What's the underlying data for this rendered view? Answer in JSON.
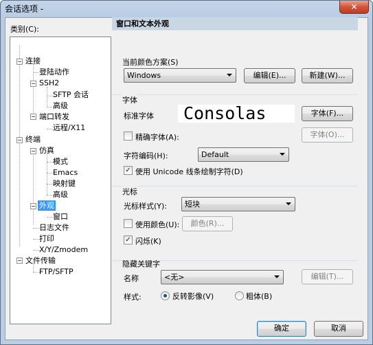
{
  "window": {
    "title": "会话选项 -",
    "close_glyph": "✕"
  },
  "category_label": "类别(C):",
  "tree": [
    {
      "label": "连接",
      "level": 0
    },
    {
      "label": "登陆动作",
      "level": 1
    },
    {
      "label": "SSH2",
      "level": 1
    },
    {
      "label": "SFTP 会话",
      "level": 2
    },
    {
      "label": "高级",
      "level": 2
    },
    {
      "label": "端口转发",
      "level": 1
    },
    {
      "label": "远程/X11",
      "level": 2
    },
    {
      "label": "终端",
      "level": 0
    },
    {
      "label": "仿真",
      "level": 1
    },
    {
      "label": "模式",
      "level": 2
    },
    {
      "label": "Emacs",
      "level": 2
    },
    {
      "label": "映射键",
      "level": 2
    },
    {
      "label": "高级",
      "level": 2
    },
    {
      "label": "外观",
      "level": 1,
      "selected": true
    },
    {
      "label": "窗口",
      "level": 2
    },
    {
      "label": "日志文件",
      "level": 1
    },
    {
      "label": "打印",
      "level": 1
    },
    {
      "label": "X/Y/Zmodem",
      "level": 1
    },
    {
      "label": "文件传输",
      "level": 0
    },
    {
      "label": "FTP/SFTP",
      "level": 1
    }
  ],
  "panel": {
    "header": "窗口和文本外观",
    "color_scheme": {
      "label": "当前颜色方案(S)",
      "value": "Windows",
      "edit": "编辑(E)...",
      "new": "新建(W)..."
    },
    "font": {
      "group_label": "字体",
      "standard_label": "标准字体",
      "standard_value": "Consolas",
      "font_button": "字体(F)...",
      "precise_label": "精确字体(A):",
      "precise_checked": false,
      "precise_button": "字体(O)...",
      "encoding_label": "字符编码(H):",
      "encoding_value": "Default",
      "unicode_label": "使用 Unicode 线条绘制字符(D)",
      "unicode_checked": true
    },
    "cursor": {
      "group_label": "光标",
      "style_label": "光标样式(Y):",
      "style_value": "短块",
      "use_color_label": "使用颜色(U):",
      "use_color_checked": false,
      "color_button": "颜色(R)...",
      "blink_label": "闪烁(K)",
      "blink_checked": true
    },
    "keyword": {
      "group_label": "隐藏关键字",
      "name_label": "名称",
      "name_value": "<无>",
      "edit_button": "编辑(T)...",
      "style_label": "样式:",
      "opt_reverse": "反转影像(V)",
      "opt_bold": "粗体(B)",
      "selected": "reverse"
    }
  },
  "footer": {
    "ok": "确定",
    "cancel": "取消"
  }
}
